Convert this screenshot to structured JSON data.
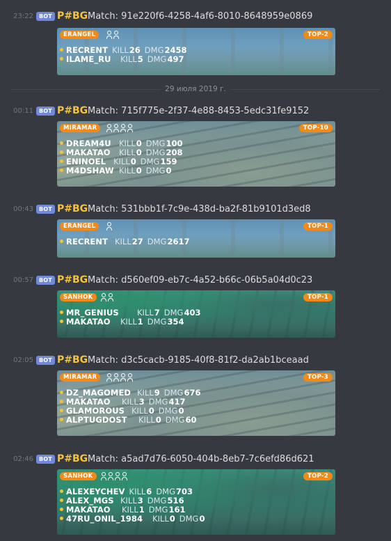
{
  "date_separator": "29 июля 2019 г.",
  "messages": [
    {
      "time": "23:22",
      "badge": "BOT",
      "author": "P#BG",
      "title": "Match: 91e220f6-4258-4af6-8010-8648959e0869",
      "map": "ERANGEL",
      "squad_size": 2,
      "top": "TOP-2",
      "players": [
        {
          "name": "RECRENT",
          "kill_label": "KILL",
          "kill": "26",
          "dmg_label": "DMG",
          "dmg": "2458"
        },
        {
          "name": "ILAME_RU",
          "kill_label": "KILL",
          "kill": "5",
          "dmg_label": "DMG",
          "dmg": "497"
        }
      ]
    },
    {
      "time": "00:11",
      "badge": "BOT",
      "author": "P#BG",
      "title": "Match: 715f775e-2f37-4e88-8453-5edc31fe9152",
      "map": "MIRAMAR",
      "squad_size": 4,
      "top": "TOP-10",
      "players": [
        {
          "name": "DREAM4U",
          "kill_label": "KILL",
          "kill": "0",
          "dmg_label": "DMG",
          "dmg": "100"
        },
        {
          "name": "MAKATAO",
          "kill_label": "KILL",
          "kill": "0",
          "dmg_label": "DMG",
          "dmg": "208"
        },
        {
          "name": "ENINOEL",
          "kill_label": "KILL",
          "kill": "0",
          "dmg_label": "DMG",
          "dmg": "159"
        },
        {
          "name": "M4DSHAW",
          "kill_label": "KILL",
          "kill": "0",
          "dmg_label": "DMG",
          "dmg": "0"
        }
      ]
    },
    {
      "time": "00:43",
      "badge": "BOT",
      "author": "P#BG",
      "title": "Match: 531bbb1f-7c9e-438d-ba2f-81b9101d3ed8",
      "map": "ERANGEL",
      "squad_size": 1,
      "top": "TOP-1",
      "players": [
        {
          "name": "RECRENT",
          "kill_label": "KILL",
          "kill": "27",
          "dmg_label": "DMG",
          "dmg": "2617"
        }
      ]
    },
    {
      "time": "00:57",
      "badge": "BOT",
      "author": "P#BG",
      "title": "Match: d560ef09-eb7c-4a52-b66c-06b5a04d0c23",
      "map": "SANHOK",
      "squad_size": 2,
      "top": "TOP-1",
      "players": [
        {
          "name": "MR_GENIUS",
          "kill_label": "KILL",
          "kill": "7",
          "dmg_label": "DMG",
          "dmg": "403"
        },
        {
          "name": "MAKATAO",
          "kill_label": "KILL",
          "kill": "1",
          "dmg_label": "DMG",
          "dmg": "354"
        }
      ]
    },
    {
      "time": "02:05",
      "badge": "BOT",
      "author": "P#BG",
      "title": "Match: d3c5cacb-9185-40f8-81f2-da2ab1bceaad",
      "map": "MIRAMAR",
      "squad_size": 4,
      "top": "TOP-3",
      "players": [
        {
          "name": "DZ_MAGOMED",
          "kill_label": "KILL",
          "kill": "9",
          "dmg_label": "DMG",
          "dmg": "676"
        },
        {
          "name": "MAKATAO",
          "kill_label": "KILL",
          "kill": "3",
          "dmg_label": "DMG",
          "dmg": "417"
        },
        {
          "name": "GLAMOROUS",
          "kill_label": "KILL",
          "kill": "0",
          "dmg_label": "DMG",
          "dmg": "0"
        },
        {
          "name": "ALPTUGDOST",
          "kill_label": "KILL",
          "kill": "0",
          "dmg_label": "DMG",
          "dmg": "60"
        }
      ]
    },
    {
      "time": "02:46",
      "badge": "BOT",
      "author": "P#BG",
      "title": "Match: a5ad7d76-6050-404b-8eb7-7c6efd86d621",
      "map": "SANHOK",
      "squad_size": 4,
      "top": "TOP-2",
      "players": [
        {
          "name": "ALEXEYCHEV",
          "kill_label": "KILL",
          "kill": "6",
          "dmg_label": "DMG",
          "dmg": "703"
        },
        {
          "name": "ALEX_MGS",
          "kill_label": "KILL",
          "kill": "3",
          "dmg_label": "DMG",
          "dmg": "516"
        },
        {
          "name": "MAKATAO",
          "kill_label": "KILL",
          "kill": "1",
          "dmg_label": "DMG",
          "dmg": "161"
        },
        {
          "name": "47RU_ONIL_1984",
          "kill_label": "KILL",
          "kill": "0",
          "dmg_label": "DMG",
          "dmg": "0"
        }
      ]
    }
  ]
}
